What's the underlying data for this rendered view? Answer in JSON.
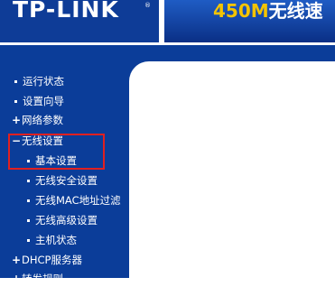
{
  "header": {
    "brand": "TP-LINK",
    "brand_mark": "®",
    "banner_highlight": "450M",
    "banner_text": "无线速"
  },
  "sidebar": {
    "items": [
      {
        "label": "运行状态",
        "type": "bullet"
      },
      {
        "label": "设置向导",
        "type": "bullet"
      },
      {
        "label": "网络参数",
        "type": "plus"
      },
      {
        "label": "无线设置",
        "type": "minus"
      },
      {
        "label": "基本设置",
        "type": "sub"
      },
      {
        "label": "无线安全设置",
        "type": "sub"
      },
      {
        "label": "无线MAC地址过滤",
        "type": "sub"
      },
      {
        "label": "无线高级设置",
        "type": "sub"
      },
      {
        "label": "主机状态",
        "type": "sub"
      },
      {
        "label": "DHCP服务器",
        "type": "plus"
      },
      {
        "label": "转发规则",
        "type": "plus"
      }
    ]
  },
  "icons": {
    "plus": "+",
    "minus": "−"
  },
  "colors": {
    "nav_bg": "#0b3d99",
    "highlight": "#e02020",
    "banner_accent": "#f4c400"
  }
}
